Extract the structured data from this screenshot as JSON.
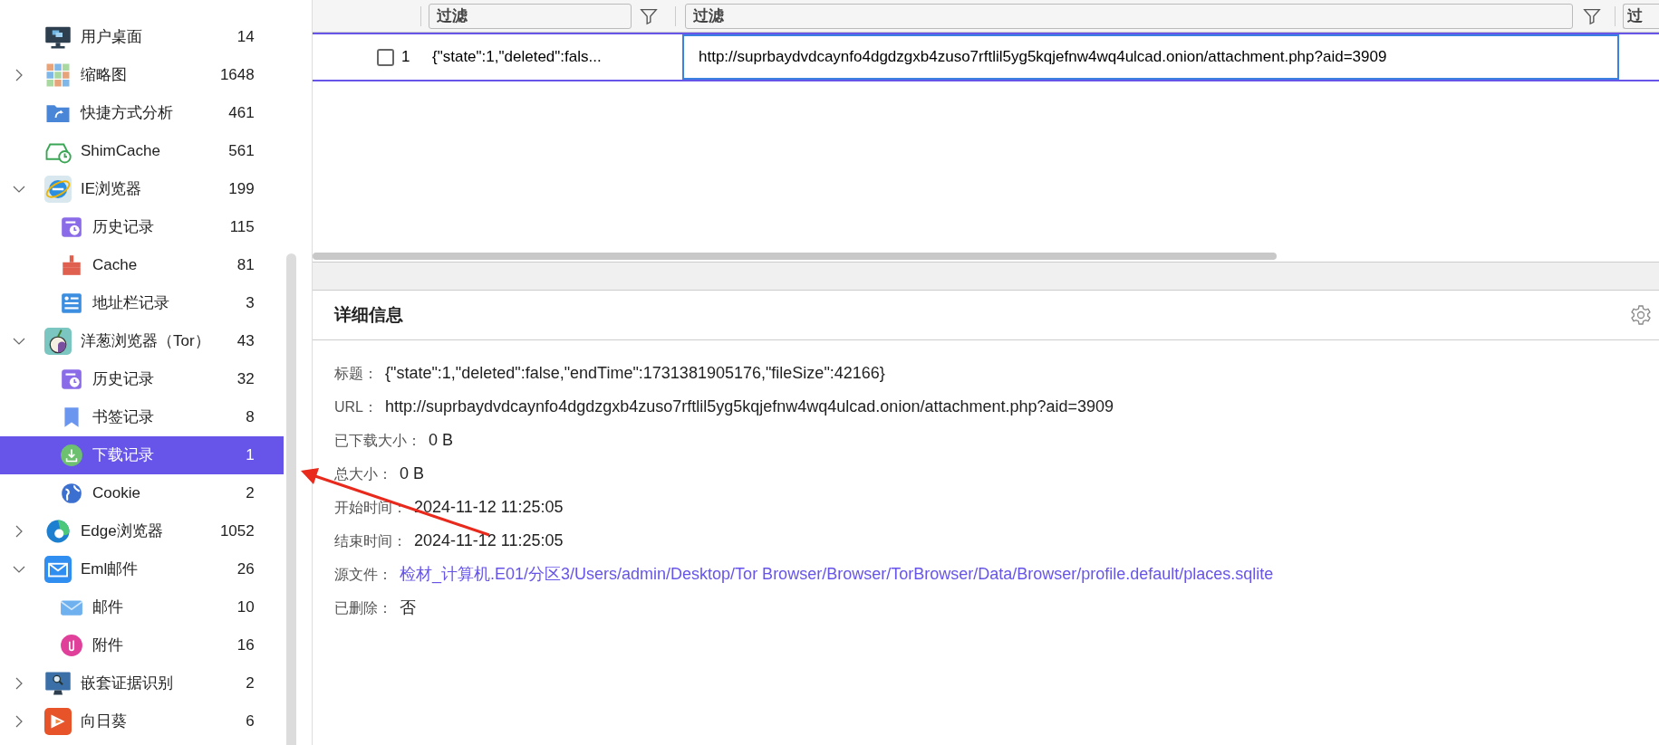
{
  "sidebar": {
    "items": [
      {
        "label": "用户桌面",
        "count": "14",
        "kind": "desktop",
        "selected": false
      },
      {
        "label": "缩略图",
        "count": "1648",
        "kind": "thumbnails",
        "selected": false,
        "expanded": false
      },
      {
        "label": "快捷方式分析",
        "count": "461",
        "kind": "shortcut",
        "selected": false
      },
      {
        "label": "ShimCache",
        "count": "561",
        "kind": "shimcache",
        "selected": false
      },
      {
        "label": "IE浏览器",
        "count": "199",
        "kind": "ie",
        "selected": false,
        "expanded": true,
        "children": [
          {
            "label": "历史记录",
            "count": "115",
            "kind": "history",
            "selected": false
          },
          {
            "label": "Cache",
            "count": "81",
            "kind": "cache",
            "selected": false
          },
          {
            "label": "地址栏记录",
            "count": "3",
            "kind": "addressbar",
            "selected": false
          }
        ]
      },
      {
        "label": "洋葱浏览器（Tor）",
        "count": "43",
        "kind": "tor",
        "selected": false,
        "expanded": true,
        "children": [
          {
            "label": "历史记录",
            "count": "32",
            "kind": "history",
            "selected": false
          },
          {
            "label": "书签记录",
            "count": "8",
            "kind": "bookmark",
            "selected": false
          },
          {
            "label": "下载记录",
            "count": "1",
            "kind": "download",
            "selected": true
          },
          {
            "label": "Cookie",
            "count": "2",
            "kind": "cookie",
            "selected": false
          }
        ]
      },
      {
        "label": "Edge浏览器",
        "count": "1052",
        "kind": "edge",
        "selected": false,
        "expanded": false
      },
      {
        "label": "Eml邮件",
        "count": "26",
        "kind": "email",
        "selected": false,
        "expanded": true,
        "children": [
          {
            "label": "邮件",
            "count": "10",
            "kind": "mail",
            "selected": false
          },
          {
            "label": "附件",
            "count": "16",
            "kind": "attachment",
            "selected": false
          }
        ]
      },
      {
        "label": "嵌套证据识别",
        "count": "2",
        "kind": "nested",
        "selected": false,
        "expanded": false
      },
      {
        "label": "向日葵",
        "count": "6",
        "kind": "sunflower",
        "selected": false,
        "expanded": false
      }
    ]
  },
  "table": {
    "filters": [
      {
        "placeholder": "过滤"
      },
      {
        "placeholder": "过滤"
      },
      {
        "placeholder": "过"
      }
    ],
    "rows": [
      {
        "checked": false,
        "number": "1",
        "title": "{\"state\":1,\"deleted\":fals...",
        "url": "http://suprbaydvdcaynfo4dgdzgxb4zuso7rftlil5yg5kqjefnw4wq4ulcad.onion/attachment.php?aid=3909",
        "selected": true
      }
    ]
  },
  "details": {
    "title": "详细信息",
    "fields": [
      {
        "label": "标题：",
        "value": "{\"state\":1,\"deleted\":false,\"endTime\":1731381905176,\"fileSize\":42166}",
        "kind": "text"
      },
      {
        "label": "URL：",
        "value": "http://suprbaydvdcaynfo4dgdzgxb4zuso7rftlil5yg5kqjefnw4wq4ulcad.onion/attachment.php?aid=3909",
        "kind": "text"
      },
      {
        "label": "已下载大小：",
        "value": "0 B",
        "kind": "text"
      },
      {
        "label": "总大小：",
        "value": "0 B",
        "kind": "text"
      },
      {
        "label": "开始时间：",
        "value": "2024-11-12 11:25:05",
        "kind": "text"
      },
      {
        "label": "结束时间：",
        "value": "2024-11-12 11:25:05",
        "kind": "text"
      },
      {
        "label": "源文件：",
        "value": "检材_计算机.E01/分区3/Users/admin/Desktop/Tor Browser/Browser/TorBrowser/Data/Browser/profile.default/places.sqlite",
        "kind": "link"
      },
      {
        "label": "已删除：",
        "value": "否",
        "kind": "text"
      }
    ]
  }
}
